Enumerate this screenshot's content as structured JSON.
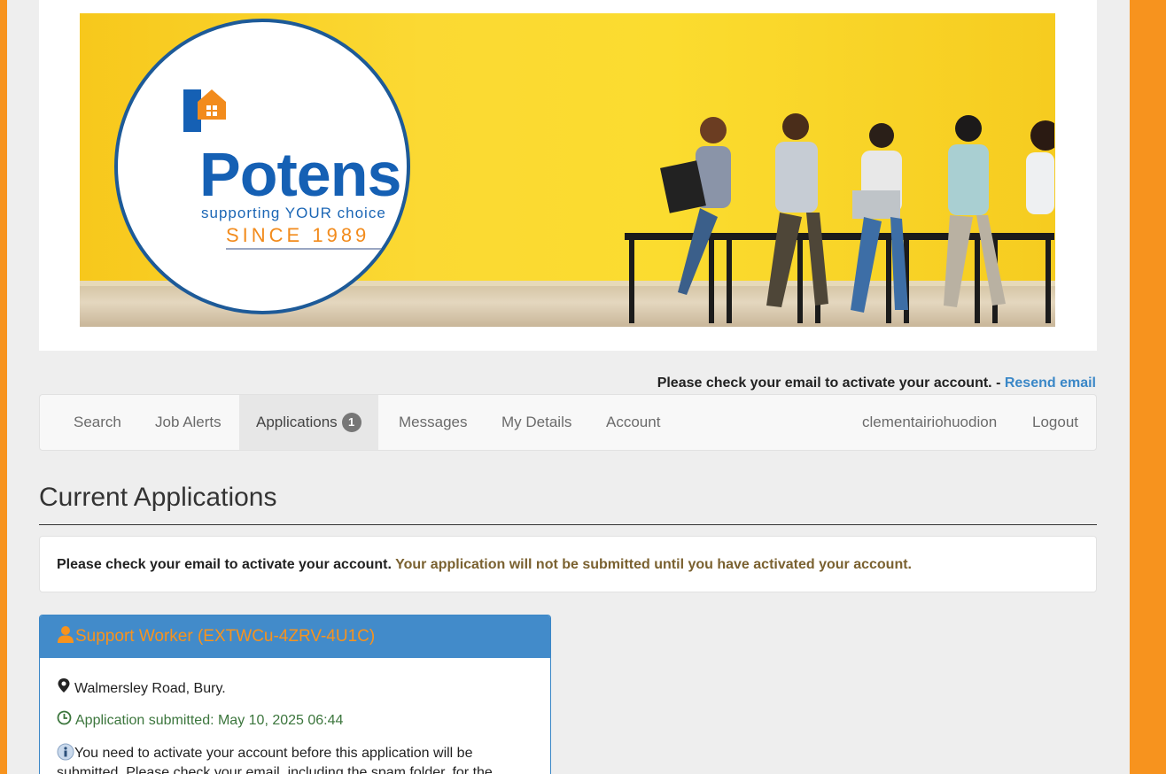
{
  "banner": {
    "logo_word": "Potens",
    "logo_tagline": "supporting YOUR choice",
    "logo_since": "SINCE 1989"
  },
  "notice": {
    "text": "Please check your email to activate your account.",
    "separator": " - ",
    "resend_label": "Resend email"
  },
  "nav": {
    "search": "Search",
    "job_alerts": "Job Alerts",
    "applications": "Applications",
    "applications_count": "1",
    "messages": "Messages",
    "my_details": "My Details",
    "account": "Account",
    "username": "clementairiohuodion",
    "logout": "Logout"
  },
  "page": {
    "title": "Current Applications"
  },
  "alert": {
    "bold": "Please check your email to activate your account.",
    "warning": "Your application will not be submitted until you have activated your account."
  },
  "application": {
    "title": "Support Worker (EXTWCu-4ZRV-4U1C)",
    "location": "Walmersley Road, Bury.",
    "submitted": "Application submitted: May 10, 2025 06:44",
    "info": "You need to activate your account before this application will be submitted. Please check your email, including the spam folder, for the"
  },
  "colors": {
    "brand_orange": "#f7931e",
    "panel_blue": "#428bca",
    "link_blue": "#3a87c7",
    "success_green": "#3c763d",
    "warning_brown": "#7a6130"
  }
}
